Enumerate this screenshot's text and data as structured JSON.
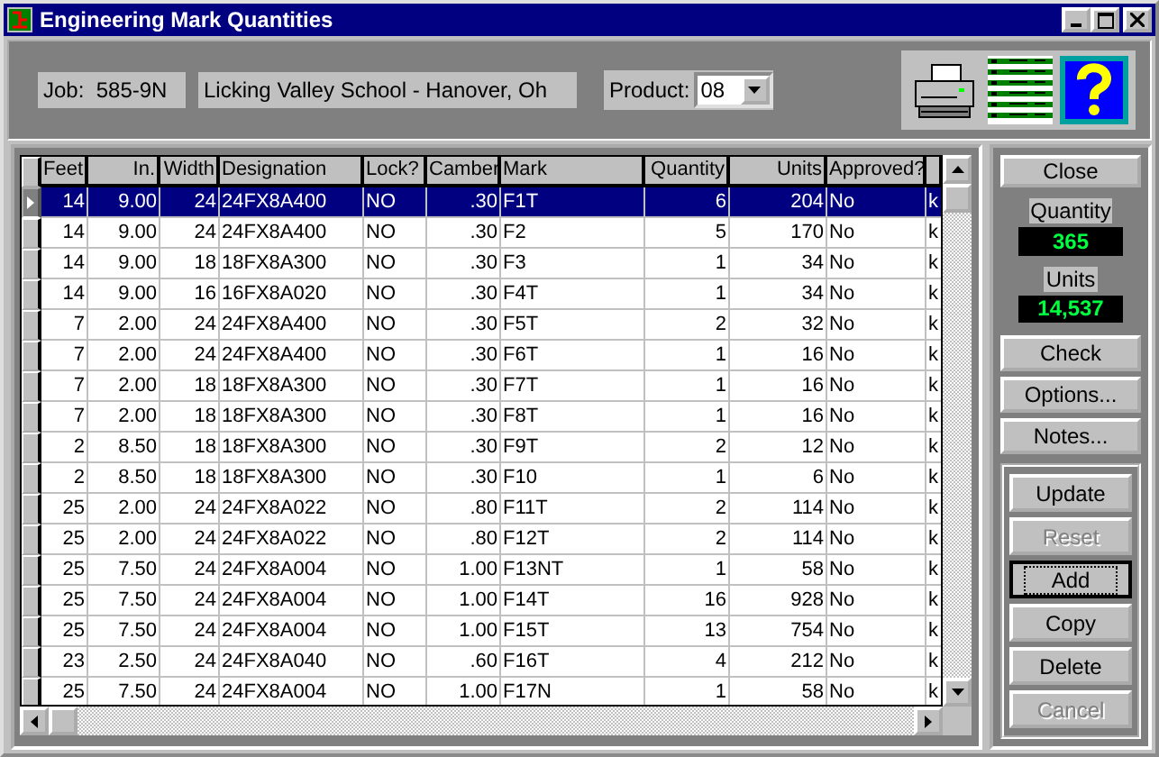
{
  "window": {
    "title": "Engineering Mark Quantities"
  },
  "header": {
    "job_label": "Job:",
    "job_value": "585-9N",
    "job_name": "Licking Valley School - Hanover, Oh",
    "product_label": "Product:",
    "product_value": "08"
  },
  "table": {
    "columns": [
      {
        "label": "Feet",
        "kind": "number"
      },
      {
        "label": "In.",
        "kind": "number"
      },
      {
        "label": "Width",
        "kind": "number"
      },
      {
        "label": "Designation",
        "kind": "text"
      },
      {
        "label": "Lock?",
        "kind": "text"
      },
      {
        "label": "Camber",
        "kind": "number"
      },
      {
        "label": "Mark",
        "kind": "text"
      },
      {
        "label": "Quantity",
        "kind": "number"
      },
      {
        "label": "Units",
        "kind": "number"
      },
      {
        "label": "Approved?",
        "kind": "text"
      },
      {
        "kind": "text"
      }
    ],
    "rows": [
      {
        "selected": true,
        "cells": [
          "14",
          "9.00",
          "24",
          "24FX8A400",
          "NO",
          ".30",
          "F1T",
          "6",
          "204",
          "No",
          "k"
        ]
      },
      {
        "selected": false,
        "cells": [
          "14",
          "9.00",
          "24",
          "24FX8A400",
          "NO",
          ".30",
          "F2",
          "5",
          "170",
          "No",
          "k"
        ]
      },
      {
        "selected": false,
        "cells": [
          "14",
          "9.00",
          "18",
          "18FX8A300",
          "NO",
          ".30",
          "F3",
          "1",
          "34",
          "No",
          "k"
        ]
      },
      {
        "selected": false,
        "cells": [
          "14",
          "9.00",
          "16",
          "16FX8A020",
          "NO",
          ".30",
          "F4T",
          "1",
          "34",
          "No",
          "k"
        ]
      },
      {
        "selected": false,
        "cells": [
          "7",
          "2.00",
          "24",
          "24FX8A400",
          "NO",
          ".30",
          "F5T",
          "2",
          "32",
          "No",
          "k"
        ]
      },
      {
        "selected": false,
        "cells": [
          "7",
          "2.00",
          "24",
          "24FX8A400",
          "NO",
          ".30",
          "F6T",
          "1",
          "16",
          "No",
          "k"
        ]
      },
      {
        "selected": false,
        "cells": [
          "7",
          "2.00",
          "18",
          "18FX8A300",
          "NO",
          ".30",
          "F7T",
          "1",
          "16",
          "No",
          "k"
        ]
      },
      {
        "selected": false,
        "cells": [
          "7",
          "2.00",
          "18",
          "18FX8A300",
          "NO",
          ".30",
          "F8T",
          "1",
          "16",
          "No",
          "k"
        ]
      },
      {
        "selected": false,
        "cells": [
          "2",
          "8.50",
          "18",
          "18FX8A300",
          "NO",
          ".30",
          "F9T",
          "2",
          "12",
          "No",
          "k"
        ]
      },
      {
        "selected": false,
        "cells": [
          "2",
          "8.50",
          "18",
          "18FX8A300",
          "NO",
          ".30",
          "F10",
          "1",
          "6",
          "No",
          "k"
        ]
      },
      {
        "selected": false,
        "cells": [
          "25",
          "2.00",
          "24",
          "24FX8A022",
          "NO",
          ".80",
          "F11T",
          "2",
          "114",
          "No",
          "k"
        ]
      },
      {
        "selected": false,
        "cells": [
          "25",
          "2.00",
          "24",
          "24FX8A022",
          "NO",
          ".80",
          "F12T",
          "2",
          "114",
          "No",
          "k"
        ]
      },
      {
        "selected": false,
        "cells": [
          "25",
          "7.50",
          "24",
          "24FX8A004",
          "NO",
          "1.00",
          "F13NT",
          "1",
          "58",
          "No",
          "k"
        ]
      },
      {
        "selected": false,
        "cells": [
          "25",
          "7.50",
          "24",
          "24FX8A004",
          "NO",
          "1.00",
          "F14T",
          "16",
          "928",
          "No",
          "k"
        ]
      },
      {
        "selected": false,
        "cells": [
          "25",
          "7.50",
          "24",
          "24FX8A004",
          "NO",
          "1.00",
          "F15T",
          "13",
          "754",
          "No",
          "k"
        ]
      },
      {
        "selected": false,
        "cells": [
          "23",
          "2.50",
          "24",
          "24FX8A040",
          "NO",
          ".60",
          "F16T",
          "4",
          "212",
          "No",
          "k"
        ]
      },
      {
        "selected": false,
        "cells": [
          "25",
          "7.50",
          "24",
          "24FX8A004",
          "NO",
          "1.00",
          "F17N",
          "1",
          "58",
          "No",
          "k"
        ]
      }
    ]
  },
  "sidebar": {
    "close_button": "Close",
    "quantity_label": "Quantity",
    "quantity_value": "365",
    "units_label": "Units",
    "units_value": "14,537",
    "buttons": [
      {
        "label": "Check"
      },
      {
        "label": "Options..."
      },
      {
        "label": "Notes..."
      }
    ],
    "edit_buttons": [
      {
        "label": "Update",
        "disabled": false,
        "focused": false
      },
      {
        "label": "Reset",
        "disabled": true,
        "focused": false
      },
      {
        "label": "Add",
        "disabled": false,
        "focused": true
      },
      {
        "label": "Copy",
        "disabled": false,
        "focused": false
      },
      {
        "label": "Delete",
        "disabled": false,
        "focused": false
      },
      {
        "label": "Cancel",
        "disabled": true,
        "focused": false
      }
    ]
  }
}
